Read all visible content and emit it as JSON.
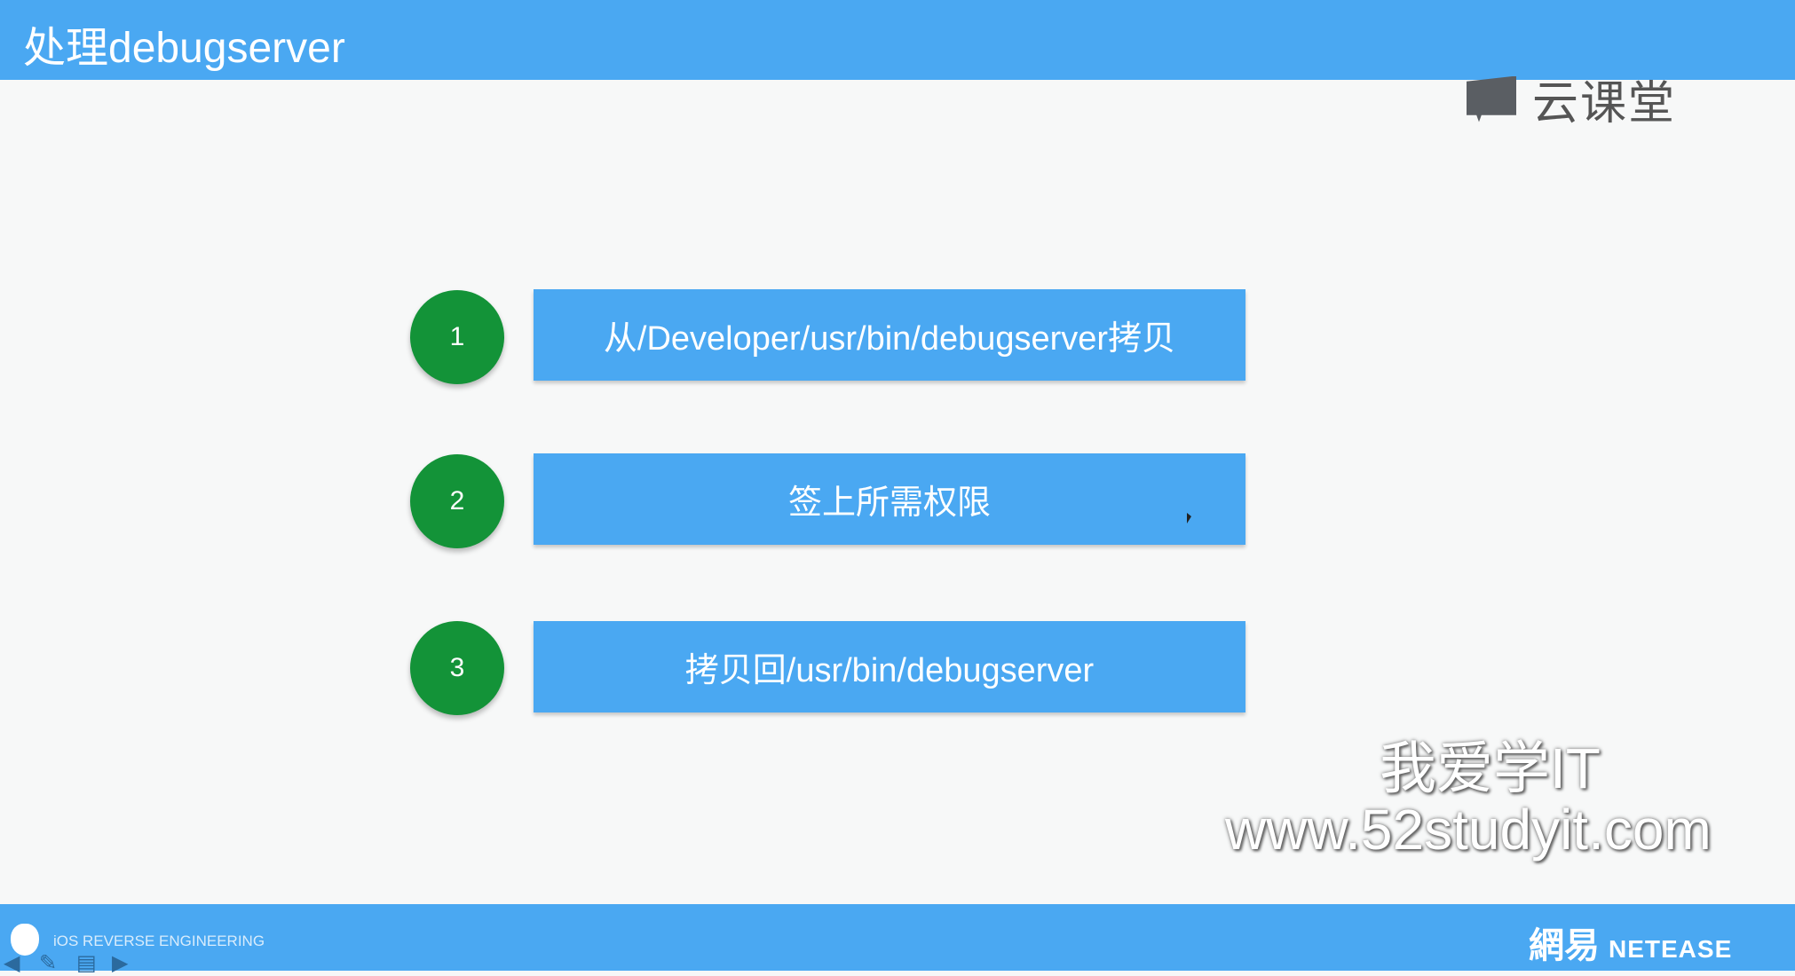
{
  "header": {
    "title": "处理debugserver"
  },
  "logo": {
    "text": "云课堂"
  },
  "steps": [
    {
      "number": "1",
      "text": "从/Developer/usr/bin/debugserver拷贝"
    },
    {
      "number": "2",
      "text": "签上所需权限"
    },
    {
      "number": "3",
      "text": "拷贝回/usr/bin/debugserver"
    }
  ],
  "watermark": {
    "line1": "我爱学IT",
    "line2": "www.52studyit.com"
  },
  "footer": {
    "text": "iOS REVERSE ENGINEERING",
    "brand_cn": "網易",
    "brand_en": "NETEASE"
  }
}
